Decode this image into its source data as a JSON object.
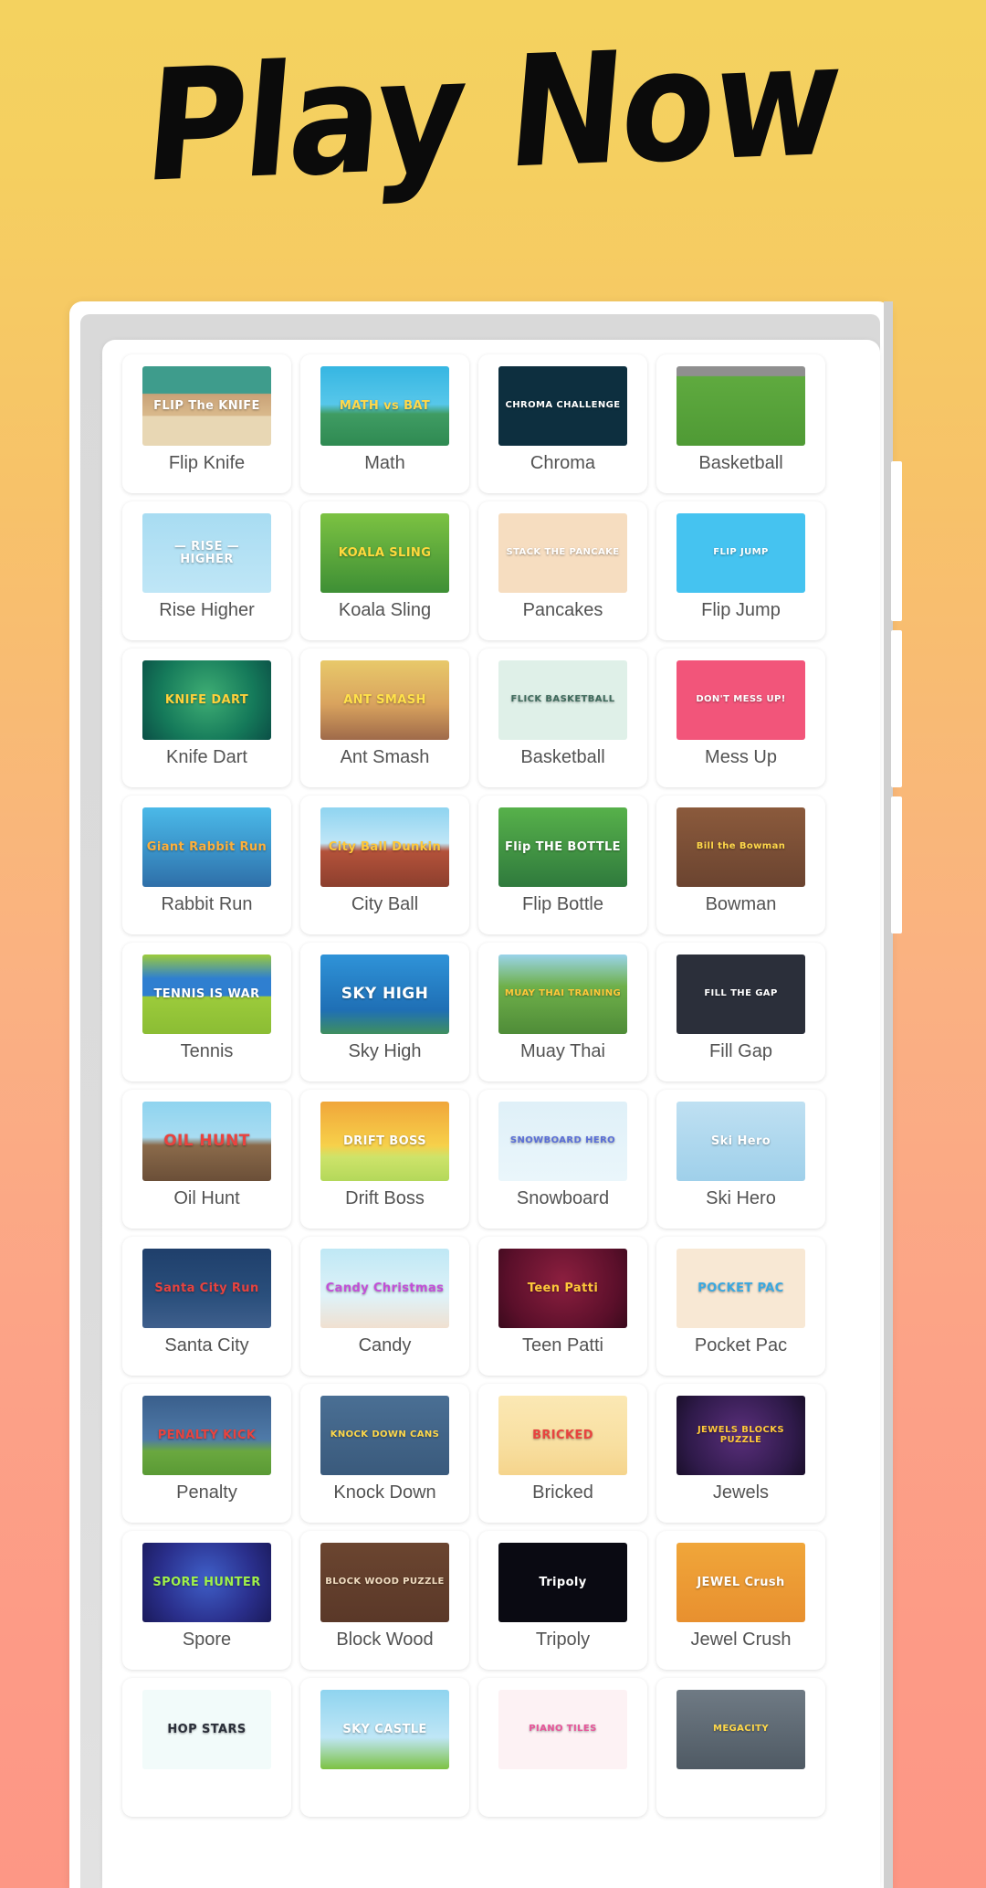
{
  "header": {
    "title": "Play Now"
  },
  "colors": {
    "bg_top": "#f4d25f",
    "bg_bottom": "#fd9785",
    "panel": "#ffffff",
    "caption": "#535353",
    "scrollbar_track": "#d0d0d0",
    "scrollbar_thumb": "#ffffff"
  },
  "scrollbar": {
    "visible": true,
    "position": "right"
  },
  "grid": {
    "columns": 4,
    "visible_rows": 11,
    "last_row_clipped": true
  },
  "games": [
    {
      "caption": "Flip Knife",
      "thumb_title": "FLIP The KNIFE",
      "thumb_size": "t2",
      "bg": "linear-gradient(180deg,#3e9c8c 0%,#3e9c8c 34%,#c9a277 35%,#d9b98c 62%,#e8d7b4 63%,#e8d7b4 100%)",
      "fg": "#ffffff"
    },
    {
      "caption": "Math",
      "thumb_title": "MATH vs BAT",
      "thumb_size": "t2",
      "bg": "linear-gradient(180deg,#36b6e2 0%,#57c7ea 48%,#3f9c63 60%,#2f8a52 100%)",
      "fg": "#ffd84a"
    },
    {
      "caption": "Chroma",
      "thumb_title": "CHROMA CHALLENGE",
      "thumb_size": "t3",
      "bg": "#0d2f3f",
      "fg": "#ffffff"
    },
    {
      "caption": "Basketball",
      "thumb_title": "",
      "thumb_size": "t3",
      "bg": "linear-gradient(180deg,#8f8f8f 0%,#8f8f8f 12%,#5faa3f 13%,#4f9a35 100%)",
      "fg": "#ffffff"
    },
    {
      "caption": "Rise Higher",
      "thumb_title": "— RISE — HIGHER",
      "thumb_size": "t2",
      "bg": "linear-gradient(180deg,#a8dcf2 0%,#bfe6f6 100%)",
      "fg": "#ffffff"
    },
    {
      "caption": "Koala Sling",
      "thumb_title": "KOALA SLING",
      "thumb_size": "t2",
      "bg": "linear-gradient(180deg,#7cc242 0%,#3e8f35 100%)",
      "fg": "#ffd93d"
    },
    {
      "caption": "Pancakes",
      "thumb_title": "STACK THE PANCAKE",
      "thumb_size": "t3",
      "bg": "#f6ddc0",
      "fg": "#ffffff"
    },
    {
      "caption": "Flip Jump",
      "thumb_title": "FLIP JUMP",
      "thumb_size": "t3",
      "bg": "#45c3f0",
      "fg": "#ffffff"
    },
    {
      "caption": "Knife Dart",
      "thumb_title": "KNIFE DART",
      "thumb_size": "t2",
      "bg": "radial-gradient(circle at 50% 45%,#3fae74 0%,#157a5a 60%,#0b4f46 100%)",
      "fg": "#ffd13b"
    },
    {
      "caption": "Ant Smash",
      "thumb_title": "ANT SMASH",
      "thumb_size": "t2",
      "bg": "linear-gradient(180deg,#e8c96a 0%,#d9a35e 55%,#9f6a4a 100%)",
      "fg": "#ffe14a"
    },
    {
      "caption": "Basketball",
      "thumb_title": "FLICK BASKETBALL",
      "thumb_size": "t3",
      "bg": "#dff0e8",
      "fg": "#3f6b5d"
    },
    {
      "caption": "Mess Up",
      "thumb_title": "DON'T MESS UP!",
      "thumb_size": "t3",
      "bg": "#f2557a",
      "fg": "#ffffff"
    },
    {
      "caption": "Rabbit Run",
      "thumb_title": "Giant Rabbit Run",
      "thumb_size": "t2",
      "bg": "linear-gradient(180deg,#4bb9e8 0%,#3a92c8 55%,#2f6fa8 100%)",
      "fg": "#ffb03a"
    },
    {
      "caption": "City Ball",
      "thumb_title": "City Ball Dunkin",
      "thumb_size": "t2",
      "bg": "linear-gradient(180deg,#8fd4f0 0%,#c0e6f7 45%,#b4523a 55%,#8c3f2e 100%)",
      "fg": "#ffc83a"
    },
    {
      "caption": "Flip Bottle",
      "thumb_title": "Flip THE BOTTLE",
      "thumb_size": "t2",
      "bg": "linear-gradient(180deg,#57b14a 0%,#2f7a3d 100%)",
      "fg": "#ffffff"
    },
    {
      "caption": "Bowman",
      "thumb_title": "Bill the Bowman",
      "thumb_size": "t3",
      "bg": "linear-gradient(180deg,#8b5a3c 0%,#6b4430 100%)",
      "fg": "#ffd84a"
    },
    {
      "caption": "Tennis",
      "thumb_title": "TENNIS IS WAR",
      "thumb_size": "t2",
      "bg": "linear-gradient(180deg,#9ccb3b 0%,#2f7fd0 30%,#2f7fd0 52%,#9ccb3b 53%,#8bbd34 100%)",
      "fg": "#ffffff"
    },
    {
      "caption": "Sky High",
      "thumb_title": "SKY HIGH",
      "thumb_size": "t1",
      "bg": "linear-gradient(180deg,#2f93d8 0%,#1f6fb5 70%,#3f8f5f 100%)",
      "fg": "#ffffff"
    },
    {
      "caption": "Muay Thai",
      "thumb_title": "MUAY THAI TRAINING",
      "thumb_size": "t3",
      "bg": "linear-gradient(180deg,#9ad4ea 0%,#6fb04a 40%,#4f8c38 100%)",
      "fg": "#ffc83a"
    },
    {
      "caption": "Fill Gap",
      "thumb_title": "FILL THE GAP",
      "thumb_size": "t3",
      "bg": "#2b2f3a",
      "fg": "#ffffff"
    },
    {
      "caption": "Oil Hunt",
      "thumb_title": "OIL HUNT",
      "thumb_size": "t1",
      "bg": "linear-gradient(180deg,#8fd4ef 0%,#a8dcf2 45%,#8a6a4a 55%,#6b4f38 100%)",
      "fg": "#e8433f"
    },
    {
      "caption": "Drift Boss",
      "thumb_title": "DRIFT BOSS",
      "thumb_size": "t2",
      "bg": "linear-gradient(180deg,#f0a63a 0%,#f7d04a 55%,#cde36a 70%,#b4d85a 100%)",
      "fg": "#ffffff"
    },
    {
      "caption": "Snowboard",
      "thumb_title": "SNOWBOARD HERO",
      "thumb_size": "t3",
      "bg": "linear-gradient(180deg,#dff0f8 0%,#eaf6fb 100%)",
      "fg": "#5a6fd8"
    },
    {
      "caption": "Ski Hero",
      "thumb_title": "Ski Hero",
      "thumb_size": "t2",
      "bg": "linear-gradient(180deg,#bfe0f2 0%,#9fd0ea 100%)",
      "fg": "#ffffff"
    },
    {
      "caption": "Santa City",
      "thumb_title": "Santa City Run",
      "thumb_size": "t2",
      "bg": "linear-gradient(180deg,#1f3f6b 0%,#2a4f7c 60%,#3f5f8c 100%)",
      "fg": "#e8433f"
    },
    {
      "caption": "Candy",
      "thumb_title": "Candy Christmas",
      "thumb_size": "t2",
      "bg": "linear-gradient(180deg,#bfe8f5 0%,#dff2f8 60%,#f0e0d0 100%)",
      "fg": "#c24fd8"
    },
    {
      "caption": "Teen Patti",
      "thumb_title": "Teen Patti",
      "thumb_size": "t2",
      "bg": "radial-gradient(circle at 50% 40%,#8c1f3f 0%,#5a0f2a 70%,#3a0a1c 100%)",
      "fg": "#ffc83a"
    },
    {
      "caption": "Pocket Pac",
      "thumb_title": "POCKET PAC",
      "thumb_size": "t2",
      "bg": "#f8e8d4",
      "fg": "#3aa8e0"
    },
    {
      "caption": "Penalty",
      "thumb_title": "PENALTY KICK",
      "thumb_size": "t2",
      "bg": "linear-gradient(180deg,#3a5f8c 0%,#4f7aa8 55%,#6aa83f 70%,#5a9a35 100%)",
      "fg": "#e8433f"
    },
    {
      "caption": "Knock Down",
      "thumb_title": "KNOCK DOWN CANS",
      "thumb_size": "t3",
      "bg": "linear-gradient(180deg,#4a6f94 0%,#3a5a7c 100%)",
      "fg": "#ffd84a"
    },
    {
      "caption": "Bricked",
      "thumb_title": "BRICKED",
      "thumb_size": "t2",
      "bg": "linear-gradient(180deg,#fbe8b4 0%,#f8dfa0 62%,#f5d48c 100%)",
      "fg": "#e8433f"
    },
    {
      "caption": "Jewels",
      "thumb_title": "JEWELS BLOCKS PUZZLE",
      "thumb_size": "t3",
      "bg": "radial-gradient(circle at 50% 50%,#5a2f7c 0%,#2f1a4a 70%,#1a0f2a 100%)",
      "fg": "#ffc83a"
    },
    {
      "caption": "Spore",
      "thumb_title": "SPORE HUNTER",
      "thumb_size": "t2",
      "bg": "radial-gradient(circle at 50% 45%,#3f5fc8 0%,#2a2f8c 60%,#1a1a5a 100%)",
      "fg": "#9ff04a"
    },
    {
      "caption": "Block Wood",
      "thumb_title": "BLOCK WOOD PUZZLE",
      "thumb_size": "t3",
      "bg": "linear-gradient(180deg,#6b4530 0%,#5a3828 100%)",
      "fg": "#f0dcc0"
    },
    {
      "caption": "Tripoly",
      "thumb_title": "Tripoly",
      "thumb_size": "t2",
      "bg": "#0a0a12",
      "fg": "#ffffff"
    },
    {
      "caption": "Jewel Crush",
      "thumb_title": "JEWEL Crush",
      "thumb_size": "t2",
      "bg": "linear-gradient(180deg,#f0a63a 0%,#e8902f 100%)",
      "fg": "#ffffff"
    },
    {
      "caption": "",
      "thumb_title": "HOP STARS",
      "thumb_size": "t2",
      "bg": "#f2fbfa",
      "fg": "#2b2f3a"
    },
    {
      "caption": "",
      "thumb_title": "SKY CASTLE",
      "thumb_size": "t2",
      "bg": "linear-gradient(180deg,#8fd4ef 0%,#bfe6f6 60%,#7cc242 100%)",
      "fg": "#ffffff"
    },
    {
      "caption": "",
      "thumb_title": "PIANO TILES",
      "thumb_size": "t3",
      "bg": "#fdf2f4",
      "fg": "#e8559a"
    },
    {
      "caption": "",
      "thumb_title": "MEGACITY",
      "thumb_size": "t3",
      "bg": "linear-gradient(180deg,#6f7a84 0%,#4f5a64 100%)",
      "fg": "#ffd84a"
    }
  ]
}
